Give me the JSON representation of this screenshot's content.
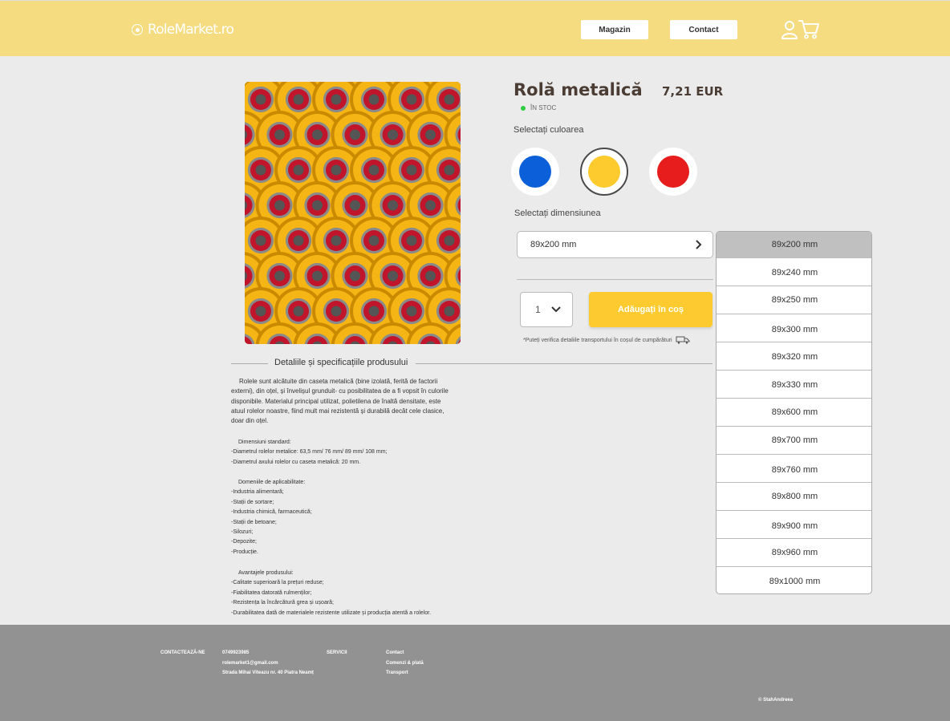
{
  "header": {
    "logo_text": "RoleMarket.ro",
    "nav": {
      "shop": "Magazin",
      "contact": "Contact"
    },
    "icons": [
      "user-icon",
      "cart-icon"
    ]
  },
  "product": {
    "title": "Rolă metalică",
    "price": "7,21 EUR",
    "stock": "ÎN STOC",
    "color_label": "Selectați culoarea",
    "colors": [
      {
        "name": "blue",
        "hex": "#0b5fd8",
        "selected": false
      },
      {
        "name": "yellow",
        "hex": "#fecb2f",
        "selected": true
      },
      {
        "name": "red",
        "hex": "#e71d1d",
        "selected": false
      }
    ],
    "size_label": "Selectați dimensiunea",
    "selected_size": "89x200 mm",
    "quantity": "1",
    "add_to_cart": "Adăugați în coș",
    "transport_note": "*Puteți verifica detaliile transportului în coșul de cumpărături"
  },
  "size_options": [
    "89x200 mm",
    "89x240 mm",
    "89x250 mm",
    "89x300 mm",
    "89x320 mm",
    "89x330 mm",
    "89x600 mm",
    "89x700 mm",
    "89x760 mm",
    "89x800 mm",
    "89x900 mm",
    "89x960 mm",
    "89x1000 mm"
  ],
  "details": {
    "heading": "Detaliile și specificațiile produsului",
    "description": [
      "Rolele sunt alcătuite din caseta metalică (bine izolată, ferită de factorii",
      "externi), din oțel, și învelișul grunduit- cu posibilitatea de a fi vopsit în culorile",
      "disponibile. Materialul principal utilizat, polietilena de înaltă densitate, este",
      "atuul rolelor noastre, fiind mult mai rezistentă și durabilă decât cele clasice,",
      "doar din oțel."
    ],
    "dimensions_title": "Dimensiuni standard:",
    "dimensions": [
      "-Diametrul rolelor metalice: 63,5 mm/ 76 mm/ 89 mm/ 108 mm;",
      "-Diametrul axului rolelor cu caseta metalică: 20 mm."
    ],
    "domains_title": "Domeniile de aplicabilitate:",
    "domains": [
      "-Industria alimentară;",
      "-Stații de sortare;",
      "-Industria chimică, farmaceutică;",
      "-Stații de betoane;",
      "-Silozuri;",
      "-Depozite;",
      "-Producție."
    ],
    "advantages_title": "Avantajele produsului:",
    "advantages": [
      "-Calitate superioară la prețuri reduse;",
      "-Fiabilitatea datorată rulmenților;",
      "-Rezistența la încărcătură grea și ușoară;",
      "-Durabilitatea dată de materialele rezistente utilizate și producția atentă a rolelor."
    ]
  },
  "footer": {
    "contact_title": "CONTACTEAZĂ-NE",
    "phone": "0749923985",
    "email": "rolemarket1@gmail.com",
    "address": "Strada Mihai Viteazu nr. 40 Piatra Neamț",
    "services_title": "SERVICII",
    "links": [
      "Contact",
      "Comenzi & plată",
      "Transport"
    ],
    "copyright": "© StahAndreea"
  }
}
